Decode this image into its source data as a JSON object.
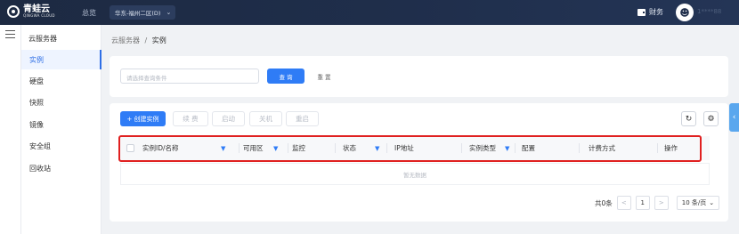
{
  "header": {
    "logo_name": "青蛙云",
    "logo_sub": "QINGWA CLOUD",
    "overview": "总览",
    "region": "华东-福州二区(D)",
    "finance": "财务",
    "username": "1****88"
  },
  "sidebar": {
    "title": "云服务器",
    "items": [
      {
        "label": "实例"
      },
      {
        "label": "硬盘"
      },
      {
        "label": "快照"
      },
      {
        "label": "镜像"
      },
      {
        "label": "安全组"
      },
      {
        "label": "回收站"
      }
    ]
  },
  "breadcrumb": {
    "parent": "云服务器",
    "separator": "/",
    "current": "实例"
  },
  "search": {
    "placeholder": "请选择查询条件",
    "query_label": "查 询",
    "reset_label": "重 置"
  },
  "toolbar": {
    "create_label": "+ 创建实例",
    "renew_label": "续 费",
    "start_label": "启动",
    "shutdown_label": "关机",
    "restart_label": "重启"
  },
  "table": {
    "columns": [
      {
        "label": "实例ID/名称"
      },
      {
        "label": "可用区"
      },
      {
        "label": "监控"
      },
      {
        "label": "状态"
      },
      {
        "label": "IP地址"
      },
      {
        "label": "实例类型"
      },
      {
        "label": "配置"
      },
      {
        "label": "计费方式"
      },
      {
        "label": "操作"
      }
    ],
    "empty_text": "暂无数据"
  },
  "pagination": {
    "total_text": "共0条",
    "current_page": "1",
    "page_size": "10 条/页"
  },
  "colors": {
    "primary": "#2f7cf6",
    "highlight": "#e02020",
    "topbar": "#1f2e4b"
  }
}
